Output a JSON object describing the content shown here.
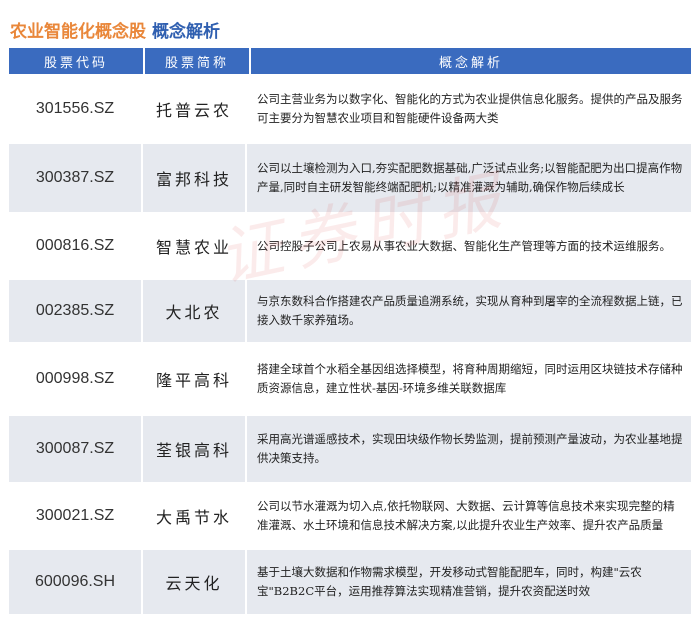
{
  "title": {
    "main": "农业智能化概念股",
    "sub": "概念解析"
  },
  "columns": [
    "股票代码",
    "股票简称",
    "概念解析"
  ],
  "watermark": "证券时报",
  "rows": [
    {
      "code": "301556.SZ",
      "name": "托普云农",
      "desc": "公司主营业务为以数字化、智能化的方式为农业提供信息化服务。提供的产品及服务可主要分为智慧农业项目和智能硬件设备两大类"
    },
    {
      "code": "300387.SZ",
      "name": "富邦科技",
      "desc": "公司以土壤检测为入口,夯实配肥数据基础,广泛试点业务;以智能配肥为出口提高作物产量,同时自主研发智能终端配肥机;以精准灌溉为辅助,确保作物后续成长"
    },
    {
      "code": "000816.SZ",
      "name": "智慧农业",
      "desc": "公司控股子公司上农易从事农业大数据、智能化生产管理等方面的技术运维服务。"
    },
    {
      "code": "002385.SZ",
      "name": "大北农",
      "desc": "与京东数科合作搭建农产品质量追溯系统，实现从育种到屠宰的全流程数据上链，已接入数千家养殖场。"
    },
    {
      "code": "000998.SZ",
      "name": "隆平高科",
      "desc": "搭建全球首个水稻全基因组选择模型，将育种周期缩短，同时运用区块链技术存储种质资源信息，建立性状-基因-环境多维关联数据库"
    },
    {
      "code": "300087.SZ",
      "name": "荃银高科",
      "desc": "采用高光谱遥感技术，实现田块级作物长势监测，提前预测产量波动，为农业基地提供决策支持。"
    },
    {
      "code": "300021.SZ",
      "name": "大禹节水",
      "desc": "公司以节水灌溉为切入点,依托物联网、大数据、云计算等信息技术来实现完整的精准灌溉、水土环境和信息技术解决方案,以此提升农业生产效率、提升农产品质量"
    },
    {
      "code": "600096.SH",
      "name": "云天化",
      "desc": "基于土壤大数据和作物需求模型，开发移动式智能配肥车，同时，构建\"云农宝\"B2B2C平台，运用推荐算法实现精准营销，提升农资配送时效"
    }
  ]
}
